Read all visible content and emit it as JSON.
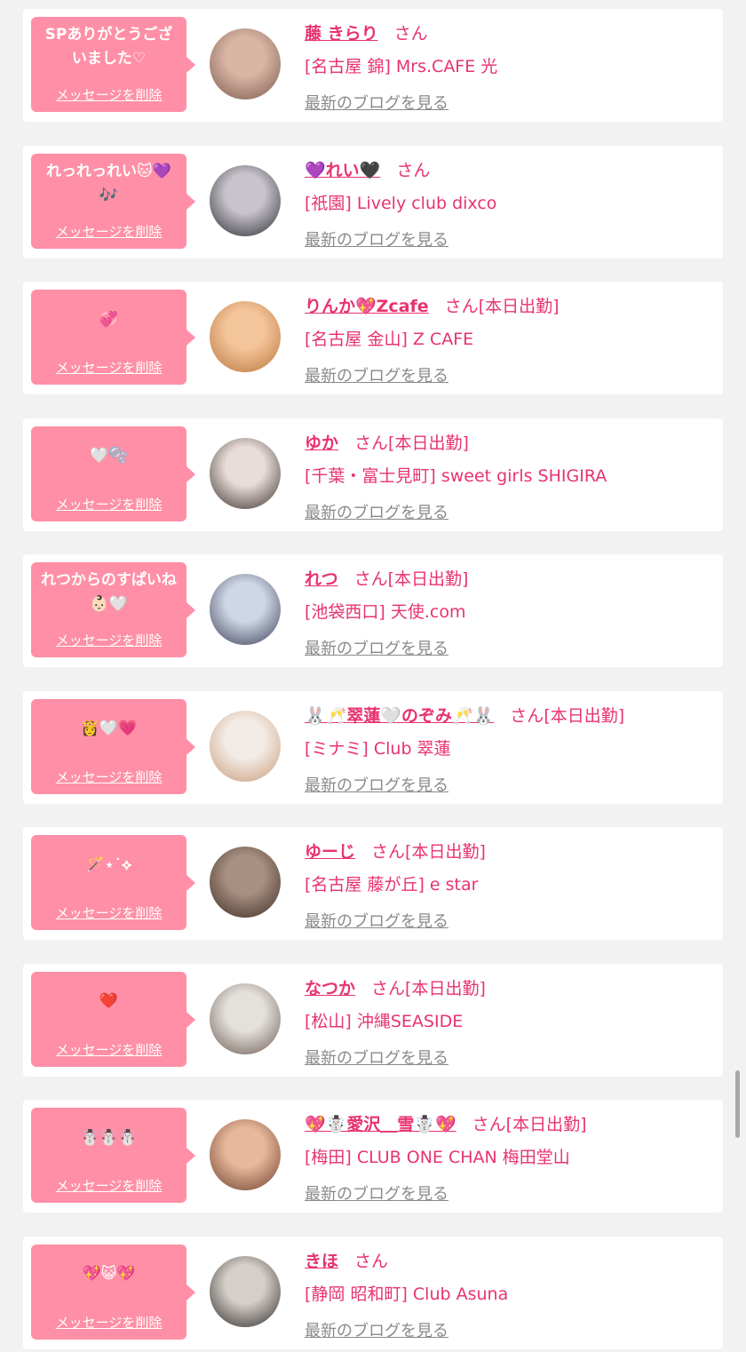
{
  "list": {
    "delete_label": "メッセージを削除",
    "blog_label": "最新のブログを見る",
    "items": [
      {
        "message": "SPありがとうございました♡",
        "name": "藤 きらり",
        "honorific": "さん",
        "status": "",
        "area": "[名古屋 錦]",
        "shop": "Mrs.CAFE 光",
        "avatar_colors": [
          "#d9b5a4",
          "#7a5a4c"
        ]
      },
      {
        "message": "れっれっれい🐱💜🎶",
        "name": "💜れい🖤",
        "honorific": "さん",
        "status": "",
        "area": "[祇園]",
        "shop": "Lively club dixco",
        "avatar_colors": [
          "#c9c4cc",
          "#2a2a30"
        ]
      },
      {
        "message": "💞",
        "name": "りんか💖Zcafe",
        "honorific": "さん",
        "status": "[本日出勤]",
        "area": "[名古屋 金山]",
        "shop": "Z CAFE",
        "avatar_colors": [
          "#f4c49a",
          "#b8763c"
        ]
      },
      {
        "message": "🤍🫧",
        "name": "ゆか",
        "honorific": "さん",
        "status": "[本日出勤]",
        "area": "[千葉・富士見町]",
        "shop": "sweet girls SHIGIRA",
        "avatar_colors": [
          "#e8ddd8",
          "#3a2e2a"
        ]
      },
      {
        "message": "れつからのすぱいね👶🏻🤍",
        "name": "れつ",
        "honorific": "さん",
        "status": "[本日出勤]",
        "area": "[池袋西口]",
        "shop": "天使.com",
        "avatar_colors": [
          "#cfd7e6",
          "#3a3e55"
        ]
      },
      {
        "message": "👸🤍💗",
        "name": "🐰🥂翠蓮🤍のぞみ🥂🐰",
        "honorific": "さん",
        "status": "[本日出勤]",
        "area": "[ミナミ]",
        "shop": "Club 翠蓮",
        "avatar_colors": [
          "#f3ece6",
          "#c99a78"
        ]
      },
      {
        "message": "🪄⋆˙⟡",
        "name": "ゆーじ",
        "honorific": "さん",
        "status": "[本日出勤]",
        "area": "[名古屋 藤が丘]",
        "shop": "e star",
        "avatar_colors": [
          "#a88f80",
          "#3b2c25"
        ]
      },
      {
        "message": "❤️",
        "name": "なつか",
        "honorific": "さん",
        "status": "[本日出勤]",
        "area": "[松山]",
        "shop": "沖縄SEASIDE",
        "avatar_colors": [
          "#e4e0dc",
          "#6b5a52"
        ]
      },
      {
        "message": "☃️☃️☃️",
        "name": "💖☃️愛沢＿雪☃️💖",
        "honorific": "さん",
        "status": "[本日出勤]",
        "area": "[梅田]",
        "shop": "CLUB ONE CHAN 梅田堂山",
        "avatar_colors": [
          "#e8b89a",
          "#6b3f2c"
        ]
      },
      {
        "message": "💖😺💖",
        "name": "きほ",
        "honorific": "さん",
        "status": "",
        "area": "[静岡 昭和町]",
        "shop": "Club Asuna",
        "avatar_colors": [
          "#d5cfc9",
          "#2e2a28"
        ]
      }
    ]
  }
}
